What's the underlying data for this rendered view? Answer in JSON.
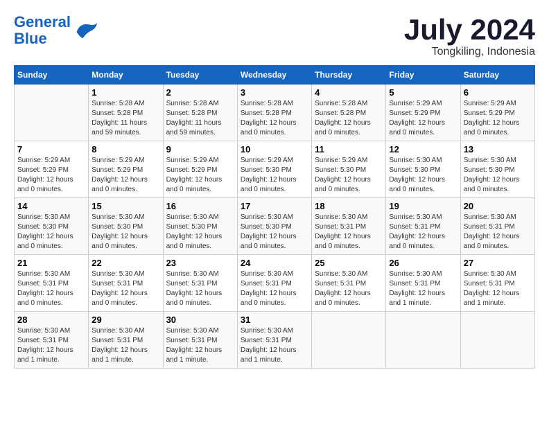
{
  "header": {
    "logo_line1": "General",
    "logo_line2": "Blue",
    "month": "July 2024",
    "location": "Tongkiling, Indonesia"
  },
  "weekdays": [
    "Sunday",
    "Monday",
    "Tuesday",
    "Wednesday",
    "Thursday",
    "Friday",
    "Saturday"
  ],
  "weeks": [
    [
      {
        "day": "",
        "info": ""
      },
      {
        "day": "1",
        "info": "Sunrise: 5:28 AM\nSunset: 5:28 PM\nDaylight: 11 hours\nand 59 minutes."
      },
      {
        "day": "2",
        "info": "Sunrise: 5:28 AM\nSunset: 5:28 PM\nDaylight: 11 hours\nand 59 minutes."
      },
      {
        "day": "3",
        "info": "Sunrise: 5:28 AM\nSunset: 5:28 PM\nDaylight: 12 hours\nand 0 minutes."
      },
      {
        "day": "4",
        "info": "Sunrise: 5:28 AM\nSunset: 5:28 PM\nDaylight: 12 hours\nand 0 minutes."
      },
      {
        "day": "5",
        "info": "Sunrise: 5:29 AM\nSunset: 5:29 PM\nDaylight: 12 hours\nand 0 minutes."
      },
      {
        "day": "6",
        "info": "Sunrise: 5:29 AM\nSunset: 5:29 PM\nDaylight: 12 hours\nand 0 minutes."
      }
    ],
    [
      {
        "day": "7",
        "info": "Sunrise: 5:29 AM\nSunset: 5:29 PM\nDaylight: 12 hours\nand 0 minutes."
      },
      {
        "day": "8",
        "info": "Sunrise: 5:29 AM\nSunset: 5:29 PM\nDaylight: 12 hours\nand 0 minutes."
      },
      {
        "day": "9",
        "info": "Sunrise: 5:29 AM\nSunset: 5:29 PM\nDaylight: 12 hours\nand 0 minutes."
      },
      {
        "day": "10",
        "info": "Sunrise: 5:29 AM\nSunset: 5:30 PM\nDaylight: 12 hours\nand 0 minutes."
      },
      {
        "day": "11",
        "info": "Sunrise: 5:29 AM\nSunset: 5:30 PM\nDaylight: 12 hours\nand 0 minutes."
      },
      {
        "day": "12",
        "info": "Sunrise: 5:30 AM\nSunset: 5:30 PM\nDaylight: 12 hours\nand 0 minutes."
      },
      {
        "day": "13",
        "info": "Sunrise: 5:30 AM\nSunset: 5:30 PM\nDaylight: 12 hours\nand 0 minutes."
      }
    ],
    [
      {
        "day": "14",
        "info": "Sunrise: 5:30 AM\nSunset: 5:30 PM\nDaylight: 12 hours\nand 0 minutes."
      },
      {
        "day": "15",
        "info": "Sunrise: 5:30 AM\nSunset: 5:30 PM\nDaylight: 12 hours\nand 0 minutes."
      },
      {
        "day": "16",
        "info": "Sunrise: 5:30 AM\nSunset: 5:30 PM\nDaylight: 12 hours\nand 0 minutes."
      },
      {
        "day": "17",
        "info": "Sunrise: 5:30 AM\nSunset: 5:30 PM\nDaylight: 12 hours\nand 0 minutes."
      },
      {
        "day": "18",
        "info": "Sunrise: 5:30 AM\nSunset: 5:31 PM\nDaylight: 12 hours\nand 0 minutes."
      },
      {
        "day": "19",
        "info": "Sunrise: 5:30 AM\nSunset: 5:31 PM\nDaylight: 12 hours\nand 0 minutes."
      },
      {
        "day": "20",
        "info": "Sunrise: 5:30 AM\nSunset: 5:31 PM\nDaylight: 12 hours\nand 0 minutes."
      }
    ],
    [
      {
        "day": "21",
        "info": "Sunrise: 5:30 AM\nSunset: 5:31 PM\nDaylight: 12 hours\nand 0 minutes."
      },
      {
        "day": "22",
        "info": "Sunrise: 5:30 AM\nSunset: 5:31 PM\nDaylight: 12 hours\nand 0 minutes."
      },
      {
        "day": "23",
        "info": "Sunrise: 5:30 AM\nSunset: 5:31 PM\nDaylight: 12 hours\nand 0 minutes."
      },
      {
        "day": "24",
        "info": "Sunrise: 5:30 AM\nSunset: 5:31 PM\nDaylight: 12 hours\nand 0 minutes."
      },
      {
        "day": "25",
        "info": "Sunrise: 5:30 AM\nSunset: 5:31 PM\nDaylight: 12 hours\nand 0 minutes."
      },
      {
        "day": "26",
        "info": "Sunrise: 5:30 AM\nSunset: 5:31 PM\nDaylight: 12 hours\nand 1 minute."
      },
      {
        "day": "27",
        "info": "Sunrise: 5:30 AM\nSunset: 5:31 PM\nDaylight: 12 hours\nand 1 minute."
      }
    ],
    [
      {
        "day": "28",
        "info": "Sunrise: 5:30 AM\nSunset: 5:31 PM\nDaylight: 12 hours\nand 1 minute."
      },
      {
        "day": "29",
        "info": "Sunrise: 5:30 AM\nSunset: 5:31 PM\nDaylight: 12 hours\nand 1 minute."
      },
      {
        "day": "30",
        "info": "Sunrise: 5:30 AM\nSunset: 5:31 PM\nDaylight: 12 hours\nand 1 minute."
      },
      {
        "day": "31",
        "info": "Sunrise: 5:30 AM\nSunset: 5:31 PM\nDaylight: 12 hours\nand 1 minute."
      },
      {
        "day": "",
        "info": ""
      },
      {
        "day": "",
        "info": ""
      },
      {
        "day": "",
        "info": ""
      }
    ]
  ]
}
